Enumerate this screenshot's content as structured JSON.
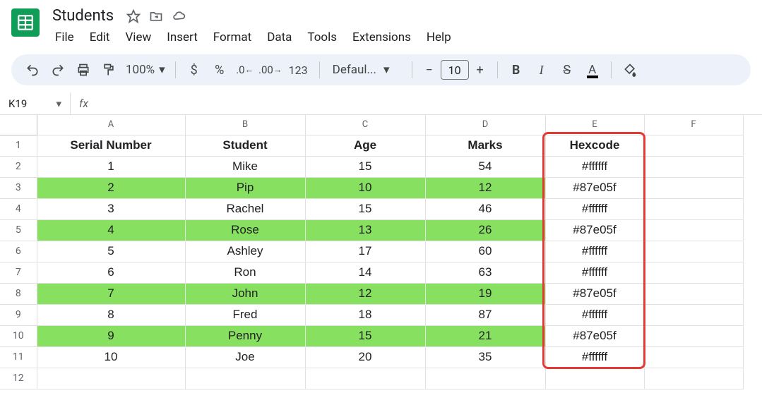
{
  "app": {
    "title": "Students",
    "menus": [
      "File",
      "Edit",
      "View",
      "Insert",
      "Format",
      "Data",
      "Tools",
      "Extensions",
      "Help"
    ]
  },
  "toolbar": {
    "zoom": "100%",
    "currency": "$",
    "percent": "%",
    "format123": "123",
    "font": "Defaul...",
    "fontsize": "10"
  },
  "namebox": "K19",
  "columns": [
    "A",
    "B",
    "C",
    "D",
    "E",
    "F"
  ],
  "header_row": {
    "serial": "Serial Number",
    "student": "Student",
    "age": "Age",
    "marks": "Marks",
    "hex": "Hexcode"
  },
  "rows": [
    {
      "num": "1",
      "serial": "1",
      "student": "Mike",
      "age": "15",
      "marks": "54",
      "hex": "#ffffff",
      "green": false
    },
    {
      "num": "2",
      "serial": "2",
      "student": "Pip",
      "age": "10",
      "marks": "12",
      "hex": "#87e05f",
      "green": true
    },
    {
      "num": "3",
      "serial": "3",
      "student": "Rachel",
      "age": "15",
      "marks": "46",
      "hex": "#ffffff",
      "green": false
    },
    {
      "num": "4",
      "serial": "4",
      "student": "Rose",
      "age": "13",
      "marks": "26",
      "hex": "#87e05f",
      "green": true
    },
    {
      "num": "5",
      "serial": "5",
      "student": "Ashley",
      "age": "17",
      "marks": "60",
      "hex": "#ffffff",
      "green": false
    },
    {
      "num": "6",
      "serial": "6",
      "student": "Ron",
      "age": "14",
      "marks": "63",
      "hex": "#ffffff",
      "green": false
    },
    {
      "num": "7",
      "serial": "7",
      "student": "John",
      "age": "12",
      "marks": "19",
      "hex": "#87e05f",
      "green": true
    },
    {
      "num": "8",
      "serial": "8",
      "student": "Fred",
      "age": "18",
      "marks": "87",
      "hex": "#ffffff",
      "green": false
    },
    {
      "num": "9",
      "serial": "9",
      "student": "Penny",
      "age": "15",
      "marks": "21",
      "hex": "#87e05f",
      "green": true
    },
    {
      "num": "10",
      "serial": "10",
      "student": "Joe",
      "age": "20",
      "marks": "35",
      "hex": "#ffffff",
      "green": false
    }
  ],
  "extra_rows": [
    "12"
  ],
  "highlight_col": "E"
}
